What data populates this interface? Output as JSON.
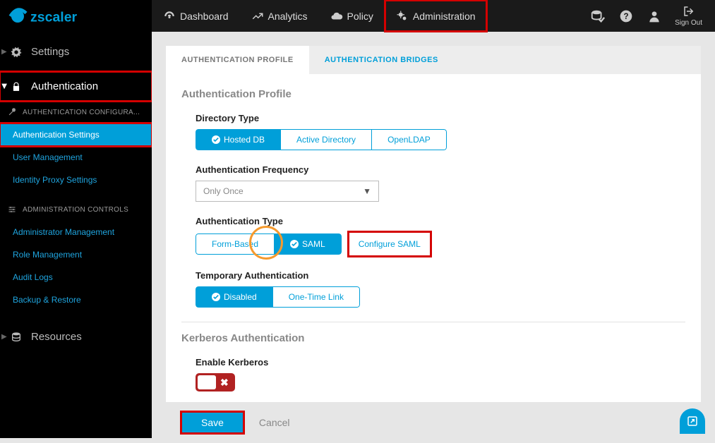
{
  "brand": "zscaler",
  "topnav": {
    "items": [
      {
        "label": "Dashboard",
        "icon": "dashboard-icon"
      },
      {
        "label": "Analytics",
        "icon": "analytics-icon"
      },
      {
        "label": "Policy",
        "icon": "policy-icon"
      },
      {
        "label": "Administration",
        "icon": "gears-icon",
        "highlight": true
      }
    ],
    "signout": "Sign Out"
  },
  "sidebar": {
    "groups": [
      {
        "label": "Settings",
        "icon": "gear"
      },
      {
        "label": "Authentication",
        "icon": "lock",
        "expanded": true,
        "highlight": true
      }
    ],
    "authSection": {
      "header": "AUTHENTICATION CONFIGURA...",
      "links": [
        {
          "label": "Authentication Settings",
          "active": true
        },
        {
          "label": "User Management"
        },
        {
          "label": "Identity Proxy Settings"
        }
      ]
    },
    "adminSection": {
      "header": "ADMINISTRATION CONTROLS",
      "links": [
        {
          "label": "Administrator Management"
        },
        {
          "label": "Role Management"
        },
        {
          "label": "Audit Logs"
        },
        {
          "label": "Backup & Restore"
        }
      ]
    },
    "resources": {
      "label": "Resources"
    }
  },
  "tabs": [
    {
      "label": "AUTHENTICATION PROFILE",
      "active": true
    },
    {
      "label": "AUTHENTICATION BRIDGES",
      "active": false
    }
  ],
  "profile": {
    "title": "Authentication Profile",
    "directory": {
      "label": "Directory Type",
      "options": [
        "Hosted DB",
        "Active Directory",
        "OpenLDAP"
      ],
      "selected": 0
    },
    "frequency": {
      "label": "Authentication Frequency",
      "value": "Only Once"
    },
    "authtype": {
      "label": "Authentication Type",
      "options": [
        "Form-Based",
        "SAML"
      ],
      "selected": 1,
      "configure": "Configure SAML"
    },
    "tempauth": {
      "label": "Temporary Authentication",
      "options": [
        "Disabled",
        "One-Time Link"
      ],
      "selected": 0
    },
    "kerberos": {
      "title": "Kerberos Authentication",
      "label": "Enable Kerberos",
      "enabled": false
    }
  },
  "footer": {
    "save": "Save",
    "cancel": "Cancel"
  }
}
